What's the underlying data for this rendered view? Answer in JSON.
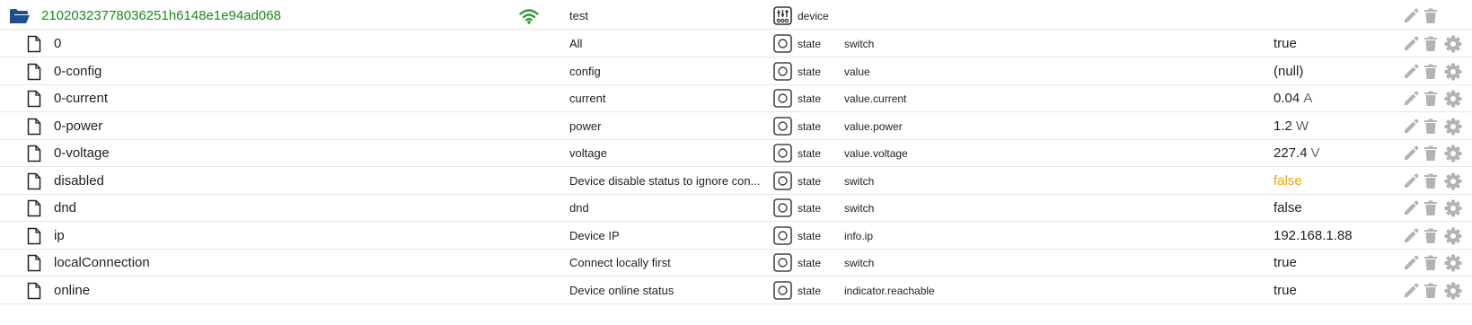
{
  "folder_row": {
    "id": "21020323778036251h6148e1e94ad068",
    "name": "test",
    "type": "device",
    "icons": {
      "expand": "folder-open-icon",
      "status": "wifi-icon",
      "type": "device-settings-icon",
      "edit": "pencil-icon",
      "delete": "trash-icon"
    },
    "colors": {
      "id": "#198a1c",
      "wifi": "#2e9b2e",
      "folder": "#1e4e8c"
    }
  },
  "states": [
    {
      "id": "0",
      "name": "All",
      "type": "state",
      "role": "switch",
      "value": "true",
      "unit": ""
    },
    {
      "id": "0-config",
      "name": "config",
      "type": "state",
      "role": "value",
      "value": "(null)",
      "unit": ""
    },
    {
      "id": "0-current",
      "name": "current",
      "type": "state",
      "role": "value.current",
      "value": "0.04",
      "unit": "A"
    },
    {
      "id": "0-power",
      "name": "power",
      "type": "state",
      "role": "value.power",
      "value": "1.2",
      "unit": "W"
    },
    {
      "id": "0-voltage",
      "name": "voltage",
      "type": "state",
      "role": "value.voltage",
      "value": "227.4",
      "unit": "V"
    },
    {
      "id": "disabled",
      "name": "Device disable status to ignore con...",
      "type": "state",
      "role": "switch",
      "value": "false",
      "unit": "",
      "value_color": "#f0a30a"
    },
    {
      "id": "dnd",
      "name": "dnd",
      "type": "state",
      "role": "switch",
      "value": "false",
      "unit": ""
    },
    {
      "id": "ip",
      "name": "Device IP",
      "type": "state",
      "role": "info.ip",
      "value": "192.168.1.88",
      "unit": ""
    },
    {
      "id": "localConnection",
      "name": "Connect locally first",
      "type": "state",
      "role": "switch",
      "value": "true",
      "unit": ""
    },
    {
      "id": "online",
      "name": "Device online status",
      "type": "state",
      "role": "indicator.reachable",
      "value": "true",
      "unit": ""
    }
  ],
  "state_row_icons": {
    "file": "file-icon",
    "type": "state-icon",
    "edit": "pencil-icon",
    "delete": "trash-icon",
    "settings": "gear-icon"
  },
  "colors": {
    "icon_gray": "#b3b3b3",
    "default_value": "#1f1f1f",
    "row_border": "#e6e6e6"
  }
}
